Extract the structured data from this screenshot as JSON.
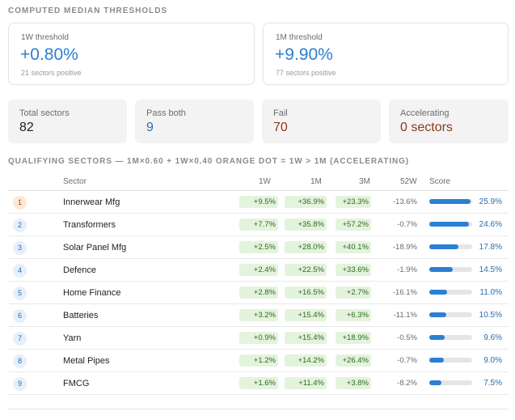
{
  "thresholds": {
    "title": "COMPUTED MEDIAN THRESHOLDS",
    "cards": [
      {
        "label": "1W threshold",
        "value": "+0.80%",
        "sub": "21 sectors positive"
      },
      {
        "label": "1M threshold",
        "value": "+9.90%",
        "sub": "77 sectors positive"
      }
    ]
  },
  "stats": [
    {
      "label": "Total sectors",
      "value": "82",
      "color": "#222222"
    },
    {
      "label": "Pass both",
      "value": "9",
      "color": "#2a6db0"
    },
    {
      "label": "Fail",
      "value": "70",
      "color": "#8b3a1c"
    },
    {
      "label": "Accelerating",
      "value": "0 sectors",
      "color": "#8b3a1c"
    }
  ],
  "qualifying": {
    "title": "QUALIFYING SECTORS — 1M×0.60 + 1W×0.40  ORANGE DOT = 1W > 1M (ACCELERATING)",
    "columns": {
      "sector": "Sector",
      "w1": "1W",
      "m1": "1M",
      "m3": "3M",
      "w52": "52W",
      "score": "Score"
    },
    "rows": [
      {
        "rank": "1",
        "sector": "Innerwear Mfg",
        "w1": "+9.5%",
        "m1": "+36.9%",
        "m3": "+23.3%",
        "w52": "-13.6%",
        "score": "25.9%",
        "score_fraction": 0.97
      },
      {
        "rank": "2",
        "sector": "Transformers",
        "w1": "+7.7%",
        "m1": "+35.8%",
        "m3": "+57.2%",
        "w52": "-0.7%",
        "score": "24.6%",
        "score_fraction": 0.93
      },
      {
        "rank": "3",
        "sector": "Solar Panel Mfg",
        "w1": "+2.5%",
        "m1": "+28.0%",
        "m3": "+40.1%",
        "w52": "-18.9%",
        "score": "17.8%",
        "score_fraction": 0.67
      },
      {
        "rank": "4",
        "sector": "Defence",
        "w1": "+2.4%",
        "m1": "+22.5%",
        "m3": "+33.6%",
        "w52": "-1.9%",
        "score": "14.5%",
        "score_fraction": 0.55
      },
      {
        "rank": "5",
        "sector": "Home Finance",
        "w1": "+2.8%",
        "m1": "+16.5%",
        "m3": "+2.7%",
        "w52": "-16.1%",
        "score": "11.0%",
        "score_fraction": 0.42
      },
      {
        "rank": "6",
        "sector": "Batteries",
        "w1": "+3.2%",
        "m1": "+15.4%",
        "m3": "+6.3%",
        "w52": "-11.1%",
        "score": "10.5%",
        "score_fraction": 0.4
      },
      {
        "rank": "7",
        "sector": "Yarn",
        "w1": "+0.9%",
        "m1": "+15.4%",
        "m3": "+18.9%",
        "w52": "-0.5%",
        "score": "9.6%",
        "score_fraction": 0.36
      },
      {
        "rank": "8",
        "sector": "Metal Pipes",
        "w1": "+1.2%",
        "m1": "+14.2%",
        "m3": "+26.4%",
        "w52": "-0.7%",
        "score": "9.0%",
        "score_fraction": 0.34
      },
      {
        "rank": "9",
        "sector": "FMCG",
        "w1": "+1.6%",
        "m1": "+11.4%",
        "m3": "+3.8%",
        "w52": "-8.2%",
        "score": "7.5%",
        "score_fraction": 0.28
      }
    ]
  }
}
